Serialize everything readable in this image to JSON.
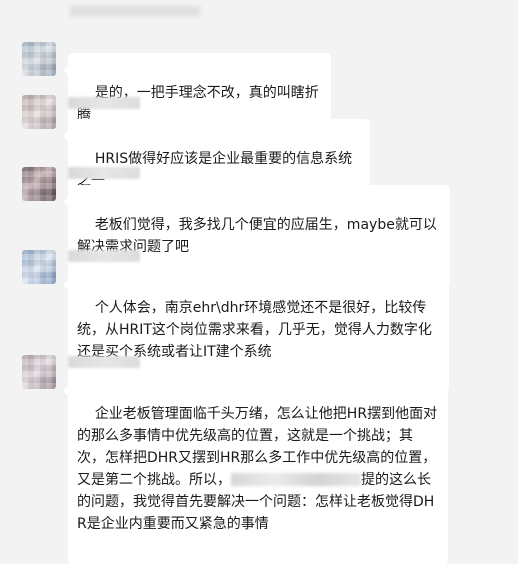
{
  "messages": [
    {
      "text": "是的，一把手理念不改，真的叫瞎折腾"
    },
    {
      "text": "HRIS做得好应该是企业最重要的信息系统之一"
    },
    {
      "text": "老板们觉得，我多找几个便宜的应届生，maybe就可以解决需求问题了吧"
    },
    {
      "text": "个人体会，南京ehr\\dhr环境感觉还不是很好，比较传统，从HRIT这个岗位需求来看，几乎无，觉得人力数字化还是买个系统或者让IT建个系统"
    },
    {
      "text_before": "企业老板管理面临千头万绪，怎么让他把HR摆到他面对的那么多事情中优先级高的位置，这就是一个挑战；其次，怎样把DHR又摆到HR那么多工作中优先级高的位置，又是第二个挑战。所以，",
      "text_after": "提的这么长的问题，我觉得首先要解决一个问题：怎样让老板觉得DHR是企业内重要而又紧急的事情"
    }
  ]
}
